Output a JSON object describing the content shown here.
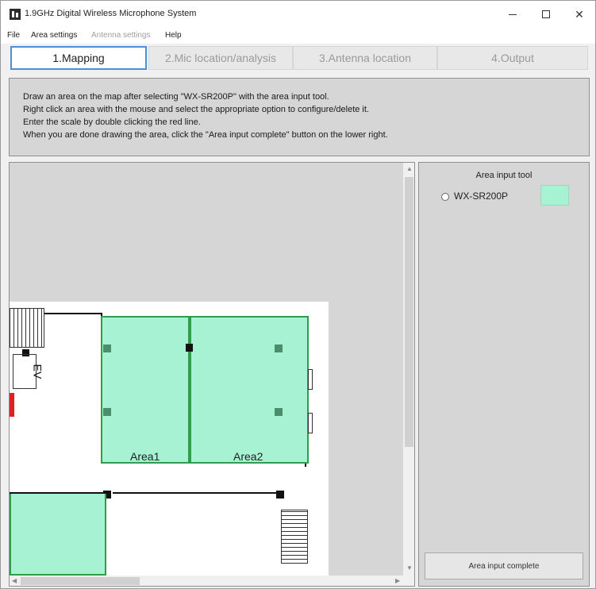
{
  "window": {
    "title": "1.9GHz Digital Wireless Microphone System"
  },
  "menu": {
    "items": [
      {
        "label": "File",
        "enabled": true
      },
      {
        "label": "Area settings",
        "enabled": true
      },
      {
        "label": "Antenna settings",
        "enabled": false
      },
      {
        "label": "Help",
        "enabled": true
      }
    ]
  },
  "tabs": [
    {
      "label": "1.Mapping",
      "active": true
    },
    {
      "label": "2.Mic location/analysis",
      "active": false
    },
    {
      "label": "3.Antenna location",
      "active": false
    },
    {
      "label": "4.Output",
      "active": false
    }
  ],
  "instructions": [
    "Draw an area on the map after selecting \"WX-SR200P\" with the area input tool.",
    "Right click an area with the mouse and select the appropriate option to configure/delete it.",
    "Enter the scale by double clicking the red line.",
    "When you are done drawing the area, click the \"Area input complete\" button on the lower right."
  ],
  "map": {
    "area_labels": [
      "Area1",
      "Area2"
    ],
    "elevator_label": "EV",
    "area_fill_color": "#a6f2d2",
    "area_border_color": "#2e9e4a"
  },
  "tool_panel": {
    "title": "Area input tool",
    "option_label": "WX-SR200P",
    "option_selected": false,
    "swatch_color": "#a6f2d2",
    "complete_button_label": "Area input complete"
  },
  "icons": {
    "app": "app-icon",
    "minimize": "minimize-icon",
    "maximize": "maximize-icon",
    "close": "close-icon"
  }
}
